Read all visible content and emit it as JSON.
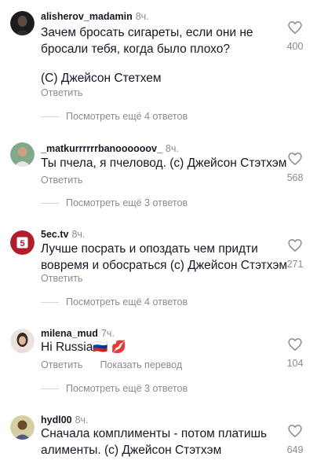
{
  "comments": [
    {
      "username": "alisherov_madamin",
      "time": "8ч.",
      "lines": [
        "Зачем бросать сигареты, если они не",
        "бросали тебя, когда было плохо?"
      ],
      "lines2": [
        "(С) Джейсон Стетхем"
      ],
      "reply_label": "Ответить",
      "replies_label": "Посмотреть ещё 4 ответов",
      "likes": "400"
    },
    {
      "username": "_matkurrrrrrbanoooooov_",
      "time": "8ч.",
      "lines": [
        "Ты пчела, я пчеловод. (с) Джейсон Стэтхэм"
      ],
      "reply_label": "Ответить",
      "replies_label": "Посмотреть ещё 3 ответов",
      "likes": "568"
    },
    {
      "username": "5ec.tv",
      "time": "8ч.",
      "lines": [
        "Лучше посрать и опоздать чем придти",
        "вовремя и обосраться (с) Джейсон Стэтхэм"
      ],
      "reply_label": "Ответить",
      "replies_label": "Посмотреть ещё 4 ответов",
      "likes": "271"
    },
    {
      "username": "milena_mud",
      "time": "7ч.",
      "lines": [
        "Hi Russia🇷🇺 💋"
      ],
      "reply_label": "Ответить",
      "translate_label": "Показать перевод",
      "replies_label": "Посмотреть ещё 3 ответов",
      "likes": "104"
    },
    {
      "username": "hydl00",
      "time": "8ч.",
      "lines": [
        "Сначала комплименты - потом платишь",
        "алименты. (с) Джейсон Стэтхэм"
      ],
      "likes": "649"
    }
  ],
  "icons": {
    "like": "heart-outline-icon"
  },
  "colors": {
    "secondary_text": "#8a8b91",
    "primary_text": "#161823"
  }
}
